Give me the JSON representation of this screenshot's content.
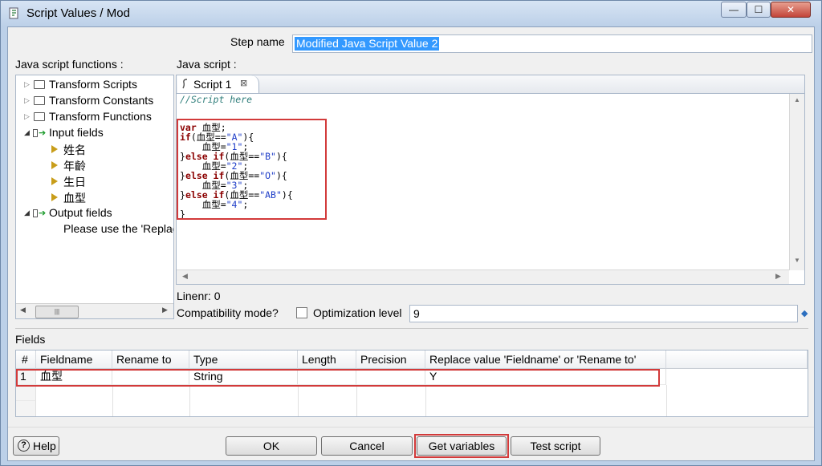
{
  "window": {
    "title": "Script Values / Mod",
    "min_glyph": "—",
    "max_glyph": "☐",
    "close_glyph": "✕"
  },
  "step": {
    "label": "Step name",
    "value": "Modified Java Script Value 2"
  },
  "functions": {
    "label": "Java script functions :",
    "tree": {
      "transform_scripts": "Transform Scripts",
      "transform_constants": "Transform Constants",
      "transform_functions": "Transform Functions",
      "input_fields": "Input fields",
      "input_children": [
        "姓名",
        "年齡",
        "生日",
        "血型"
      ],
      "output_fields": "Output fields",
      "output_hint": "Please use the 'Replace"
    },
    "scroll_glyphs": {
      "left": "◀",
      "thumb": "|||",
      "right": "▶"
    }
  },
  "script": {
    "label": "Java script :",
    "tab_label": "Script 1",
    "tab_close": "⊠",
    "comment": "//Script here",
    "lines": [
      [
        {
          "t": "var",
          "c": "kw"
        },
        {
          "t": " 血型;",
          "c": ""
        }
      ],
      [
        {
          "t": "if",
          "c": "kw"
        },
        {
          "t": "(血型==",
          "c": ""
        },
        {
          "t": "\"A\"",
          "c": "str"
        },
        {
          "t": "){",
          "c": ""
        }
      ],
      [
        {
          "t": "    血型=",
          "c": ""
        },
        {
          "t": "\"1\"",
          "c": "str"
        },
        {
          "t": ";",
          "c": ""
        }
      ],
      [
        {
          "t": "}",
          "c": ""
        },
        {
          "t": "else if",
          "c": "kw"
        },
        {
          "t": "(血型==",
          "c": ""
        },
        {
          "t": "\"B\"",
          "c": "str"
        },
        {
          "t": "){",
          "c": ""
        }
      ],
      [
        {
          "t": "    血型=",
          "c": ""
        },
        {
          "t": "\"2\"",
          "c": "str"
        },
        {
          "t": ";",
          "c": ""
        }
      ],
      [
        {
          "t": "}",
          "c": ""
        },
        {
          "t": "else if",
          "c": "kw"
        },
        {
          "t": "(血型==",
          "c": ""
        },
        {
          "t": "\"O\"",
          "c": "str"
        },
        {
          "t": "){",
          "c": ""
        }
      ],
      [
        {
          "t": "    血型=",
          "c": ""
        },
        {
          "t": "\"3\"",
          "c": "str"
        },
        {
          "t": ";",
          "c": ""
        }
      ],
      [
        {
          "t": "}",
          "c": ""
        },
        {
          "t": "else if",
          "c": "kw"
        },
        {
          "t": "(血型==",
          "c": ""
        },
        {
          "t": "\"AB\"",
          "c": "str"
        },
        {
          "t": "){",
          "c": ""
        }
      ],
      [
        {
          "t": "    血型=",
          "c": ""
        },
        {
          "t": "\"4\"",
          "c": "str"
        },
        {
          "t": ";",
          "c": ""
        }
      ],
      [
        {
          "t": "}",
          "c": ""
        }
      ]
    ],
    "scroll_glyphs": {
      "up": "▲",
      "down": "▼",
      "left": "◀",
      "right": "▶"
    },
    "linenr": "Linenr: 0"
  },
  "options": {
    "compat_label": "Compatibility mode?",
    "optimization_label": "Optimization level",
    "optimization_value": "9",
    "spin_glyph": "◆"
  },
  "fields": {
    "label": "Fields",
    "columns": [
      "#",
      "Fieldname",
      "Rename to",
      "Type",
      "Length",
      "Precision",
      "Replace value 'Fieldname' or 'Rename to'"
    ],
    "rows": [
      [
        "1",
        "血型",
        "",
        "String",
        "",
        "",
        "Y"
      ]
    ]
  },
  "buttons": {
    "help": "Help",
    "help_glyph": "?",
    "ok": "OK",
    "cancel": "Cancel",
    "get_variables": "Get variables",
    "test_script": "Test script"
  },
  "colors": {
    "highlight_red": "#d23a3a",
    "keyword": "#8b0000",
    "string": "#1e3dc8",
    "selection_blue": "#3399ff"
  }
}
